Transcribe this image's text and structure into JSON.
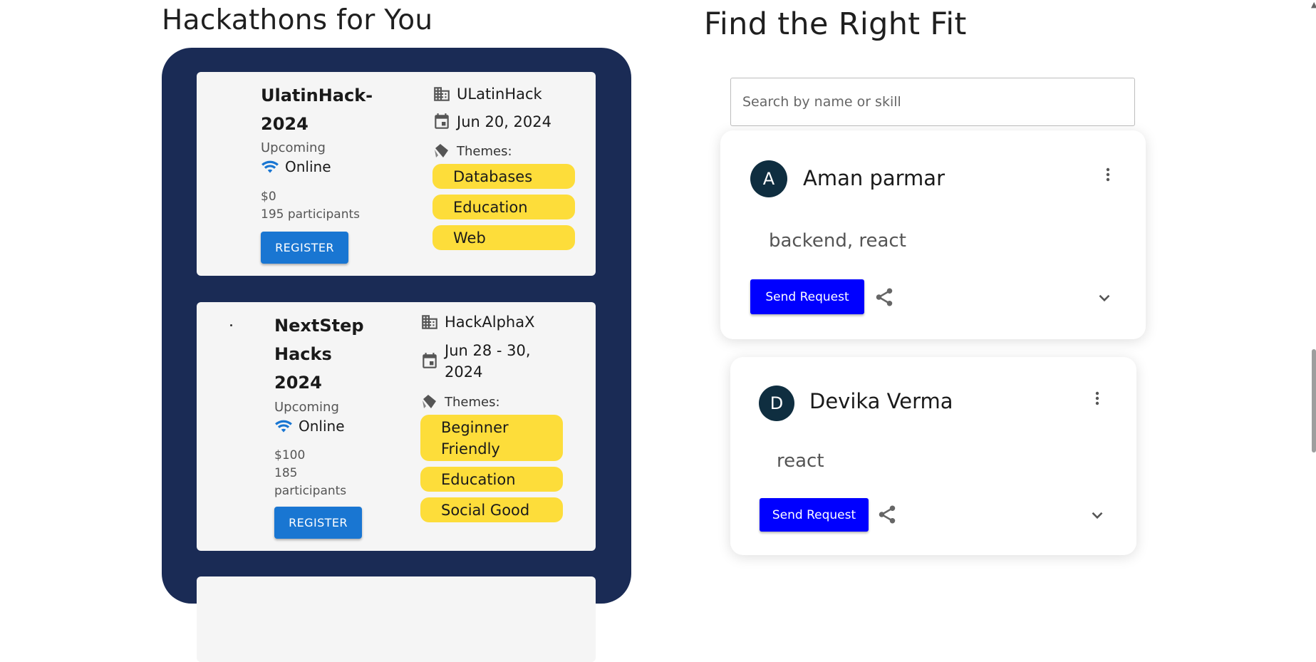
{
  "sections": {
    "hackathons_title": "Hackathons for You",
    "fit_title": "Find the Right Fit"
  },
  "hackathons": [
    {
      "name": "UlatinHack-2024",
      "name_line1": "UlatinHack-",
      "name_line2": "2024",
      "status": "Upcoming",
      "mode": "Online",
      "prize": "$0",
      "participants": "195 participants",
      "register_label": "REGISTER",
      "organizer": "ULatinHack",
      "date": "Jun 20, 2024",
      "themes_label": "Themes:",
      "themes": [
        "Databases",
        "Education",
        "Web"
      ]
    },
    {
      "name": "NextStep Hacks 2024",
      "name_line1": "NextStep",
      "name_line2": "Hacks",
      "name_line3": "2024",
      "status": "Upcoming",
      "mode": "Online",
      "prize": "$100",
      "participants_line1": "185",
      "participants_line2": "participants",
      "register_label": "REGISTER",
      "organizer": "HackAlphaX",
      "date_line1": "Jun 28 - 30,",
      "date_line2": "2024",
      "themes_label": "Themes:",
      "themes": [
        "Beginner Friendly",
        "Education",
        "Social Good"
      ],
      "theme_1_line1": "Beginner",
      "theme_1_line2": "Friendly"
    }
  ],
  "search": {
    "placeholder": "Search by name or skill"
  },
  "people": [
    {
      "initial": "A",
      "name": "Aman parmar",
      "skills": "backend, react",
      "action_label": "Send Request"
    },
    {
      "initial": "D",
      "name": "Devika Verma",
      "skills": "react",
      "action_label": "Send Request"
    }
  ],
  "colors": {
    "panel_bg": "#1a2b55",
    "theme_pill": "#fddd3a",
    "register_button": "#1976d2",
    "send_request_button": "#0000ff",
    "avatar_bg": "#0f2e40",
    "online_icon": "#1976d2"
  },
  "icons": [
    "building-icon",
    "calendar-icon",
    "tag-icon",
    "wifi-icon",
    "more-vert-icon",
    "share-icon",
    "chevron-down-icon"
  ]
}
